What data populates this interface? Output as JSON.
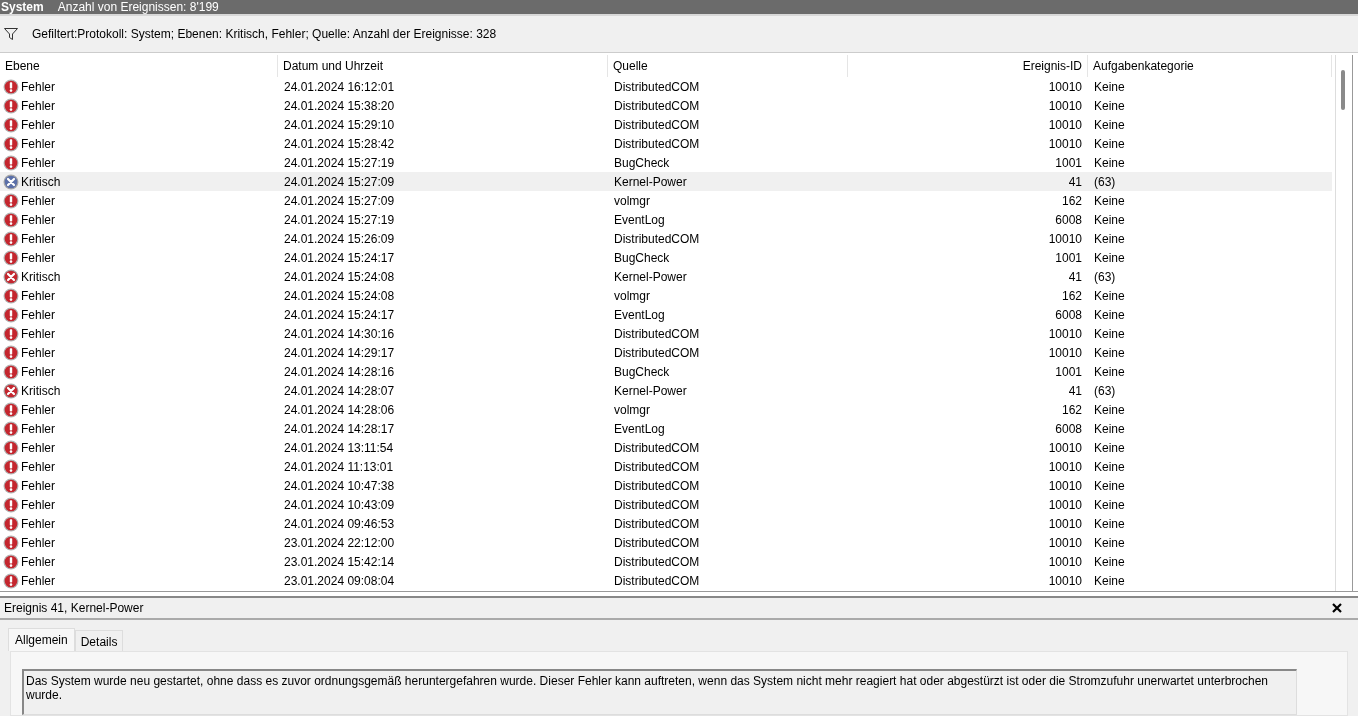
{
  "title_bar": {
    "log_name": "System",
    "event_count": "Anzahl von Ereignissen: 8'199"
  },
  "filter": {
    "text": "Gefiltert:Protokoll: System; Ebenen: Kritisch, Fehler; Quelle:  Anzahl der Ereignisse: 328"
  },
  "table": {
    "columns": [
      "Ebene",
      "Datum und Uhrzeit",
      "Quelle",
      "Ereignis-ID",
      "Aufgabenkategorie"
    ],
    "rows": [
      {
        "kind": "error",
        "level": "Fehler",
        "date": "24.01.2024 16:12:01",
        "source": "DistributedCOM",
        "id": "10010",
        "category": "Keine",
        "selected": false
      },
      {
        "kind": "error",
        "level": "Fehler",
        "date": "24.01.2024 15:38:20",
        "source": "DistributedCOM",
        "id": "10010",
        "category": "Keine",
        "selected": false
      },
      {
        "kind": "error",
        "level": "Fehler",
        "date": "24.01.2024 15:29:10",
        "source": "DistributedCOM",
        "id": "10010",
        "category": "Keine",
        "selected": false
      },
      {
        "kind": "error",
        "level": "Fehler",
        "date": "24.01.2024 15:28:42",
        "source": "DistributedCOM",
        "id": "10010",
        "category": "Keine",
        "selected": false
      },
      {
        "kind": "error",
        "level": "Fehler",
        "date": "24.01.2024 15:27:19",
        "source": "BugCheck",
        "id": "1001",
        "category": "Keine",
        "selected": false
      },
      {
        "kind": "critical",
        "level": "Kritisch",
        "date": "24.01.2024 15:27:09",
        "source": "Kernel-Power",
        "id": "41",
        "category": "(63)",
        "selected": true
      },
      {
        "kind": "error",
        "level": "Fehler",
        "date": "24.01.2024 15:27:09",
        "source": "volmgr",
        "id": "162",
        "category": "Keine",
        "selected": false
      },
      {
        "kind": "error",
        "level": "Fehler",
        "date": "24.01.2024 15:27:19",
        "source": "EventLog",
        "id": "6008",
        "category": "Keine",
        "selected": false
      },
      {
        "kind": "error",
        "level": "Fehler",
        "date": "24.01.2024 15:26:09",
        "source": "DistributedCOM",
        "id": "10010",
        "category": "Keine",
        "selected": false
      },
      {
        "kind": "error",
        "level": "Fehler",
        "date": "24.01.2024 15:24:17",
        "source": "BugCheck",
        "id": "1001",
        "category": "Keine",
        "selected": false
      },
      {
        "kind": "critical",
        "level": "Kritisch",
        "date": "24.01.2024 15:24:08",
        "source": "Kernel-Power",
        "id": "41",
        "category": "(63)",
        "selected": false
      },
      {
        "kind": "error",
        "level": "Fehler",
        "date": "24.01.2024 15:24:08",
        "source": "volmgr",
        "id": "162",
        "category": "Keine",
        "selected": false
      },
      {
        "kind": "error",
        "level": "Fehler",
        "date": "24.01.2024 15:24:17",
        "source": "EventLog",
        "id": "6008",
        "category": "Keine",
        "selected": false
      },
      {
        "kind": "error",
        "level": "Fehler",
        "date": "24.01.2024 14:30:16",
        "source": "DistributedCOM",
        "id": "10010",
        "category": "Keine",
        "selected": false
      },
      {
        "kind": "error",
        "level": "Fehler",
        "date": "24.01.2024 14:29:17",
        "source": "DistributedCOM",
        "id": "10010",
        "category": "Keine",
        "selected": false
      },
      {
        "kind": "error",
        "level": "Fehler",
        "date": "24.01.2024 14:28:16",
        "source": "BugCheck",
        "id": "1001",
        "category": "Keine",
        "selected": false
      },
      {
        "kind": "critical",
        "level": "Kritisch",
        "date": "24.01.2024 14:28:07",
        "source": "Kernel-Power",
        "id": "41",
        "category": "(63)",
        "selected": false
      },
      {
        "kind": "error",
        "level": "Fehler",
        "date": "24.01.2024 14:28:06",
        "source": "volmgr",
        "id": "162",
        "category": "Keine",
        "selected": false
      },
      {
        "kind": "error",
        "level": "Fehler",
        "date": "24.01.2024 14:28:17",
        "source": "EventLog",
        "id": "6008",
        "category": "Keine",
        "selected": false
      },
      {
        "kind": "error",
        "level": "Fehler",
        "date": "24.01.2024 13:11:54",
        "source": "DistributedCOM",
        "id": "10010",
        "category": "Keine",
        "selected": false
      },
      {
        "kind": "error",
        "level": "Fehler",
        "date": "24.01.2024 11:13:01",
        "source": "DistributedCOM",
        "id": "10010",
        "category": "Keine",
        "selected": false
      },
      {
        "kind": "error",
        "level": "Fehler",
        "date": "24.01.2024 10:47:38",
        "source": "DistributedCOM",
        "id": "10010",
        "category": "Keine",
        "selected": false
      },
      {
        "kind": "error",
        "level": "Fehler",
        "date": "24.01.2024 10:43:09",
        "source": "DistributedCOM",
        "id": "10010",
        "category": "Keine",
        "selected": false
      },
      {
        "kind": "error",
        "level": "Fehler",
        "date": "24.01.2024 09:46:53",
        "source": "DistributedCOM",
        "id": "10010",
        "category": "Keine",
        "selected": false
      },
      {
        "kind": "error",
        "level": "Fehler",
        "date": "23.01.2024 22:12:00",
        "source": "DistributedCOM",
        "id": "10010",
        "category": "Keine",
        "selected": false
      },
      {
        "kind": "error",
        "level": "Fehler",
        "date": "23.01.2024 15:42:14",
        "source": "DistributedCOM",
        "id": "10010",
        "category": "Keine",
        "selected": false
      },
      {
        "kind": "error",
        "level": "Fehler",
        "date": "23.01.2024 09:08:04",
        "source": "DistributedCOM",
        "id": "10010",
        "category": "Keine",
        "selected": false
      }
    ]
  },
  "detail": {
    "title": "Ereignis 41, Kernel-Power",
    "tabs": [
      {
        "label": "Allgemein",
        "selected": true
      },
      {
        "label": "Details",
        "selected": false
      }
    ],
    "description": "Das System wurde neu gestartet, ohne dass es zuvor ordnungsgemäß heruntergefahren wurde. Dieser Fehler kann auftreten, wenn das System nicht mehr reagiert hat oder abgestürzt ist oder die Stromzufuhr unerwartet unterbrochen wurde."
  }
}
